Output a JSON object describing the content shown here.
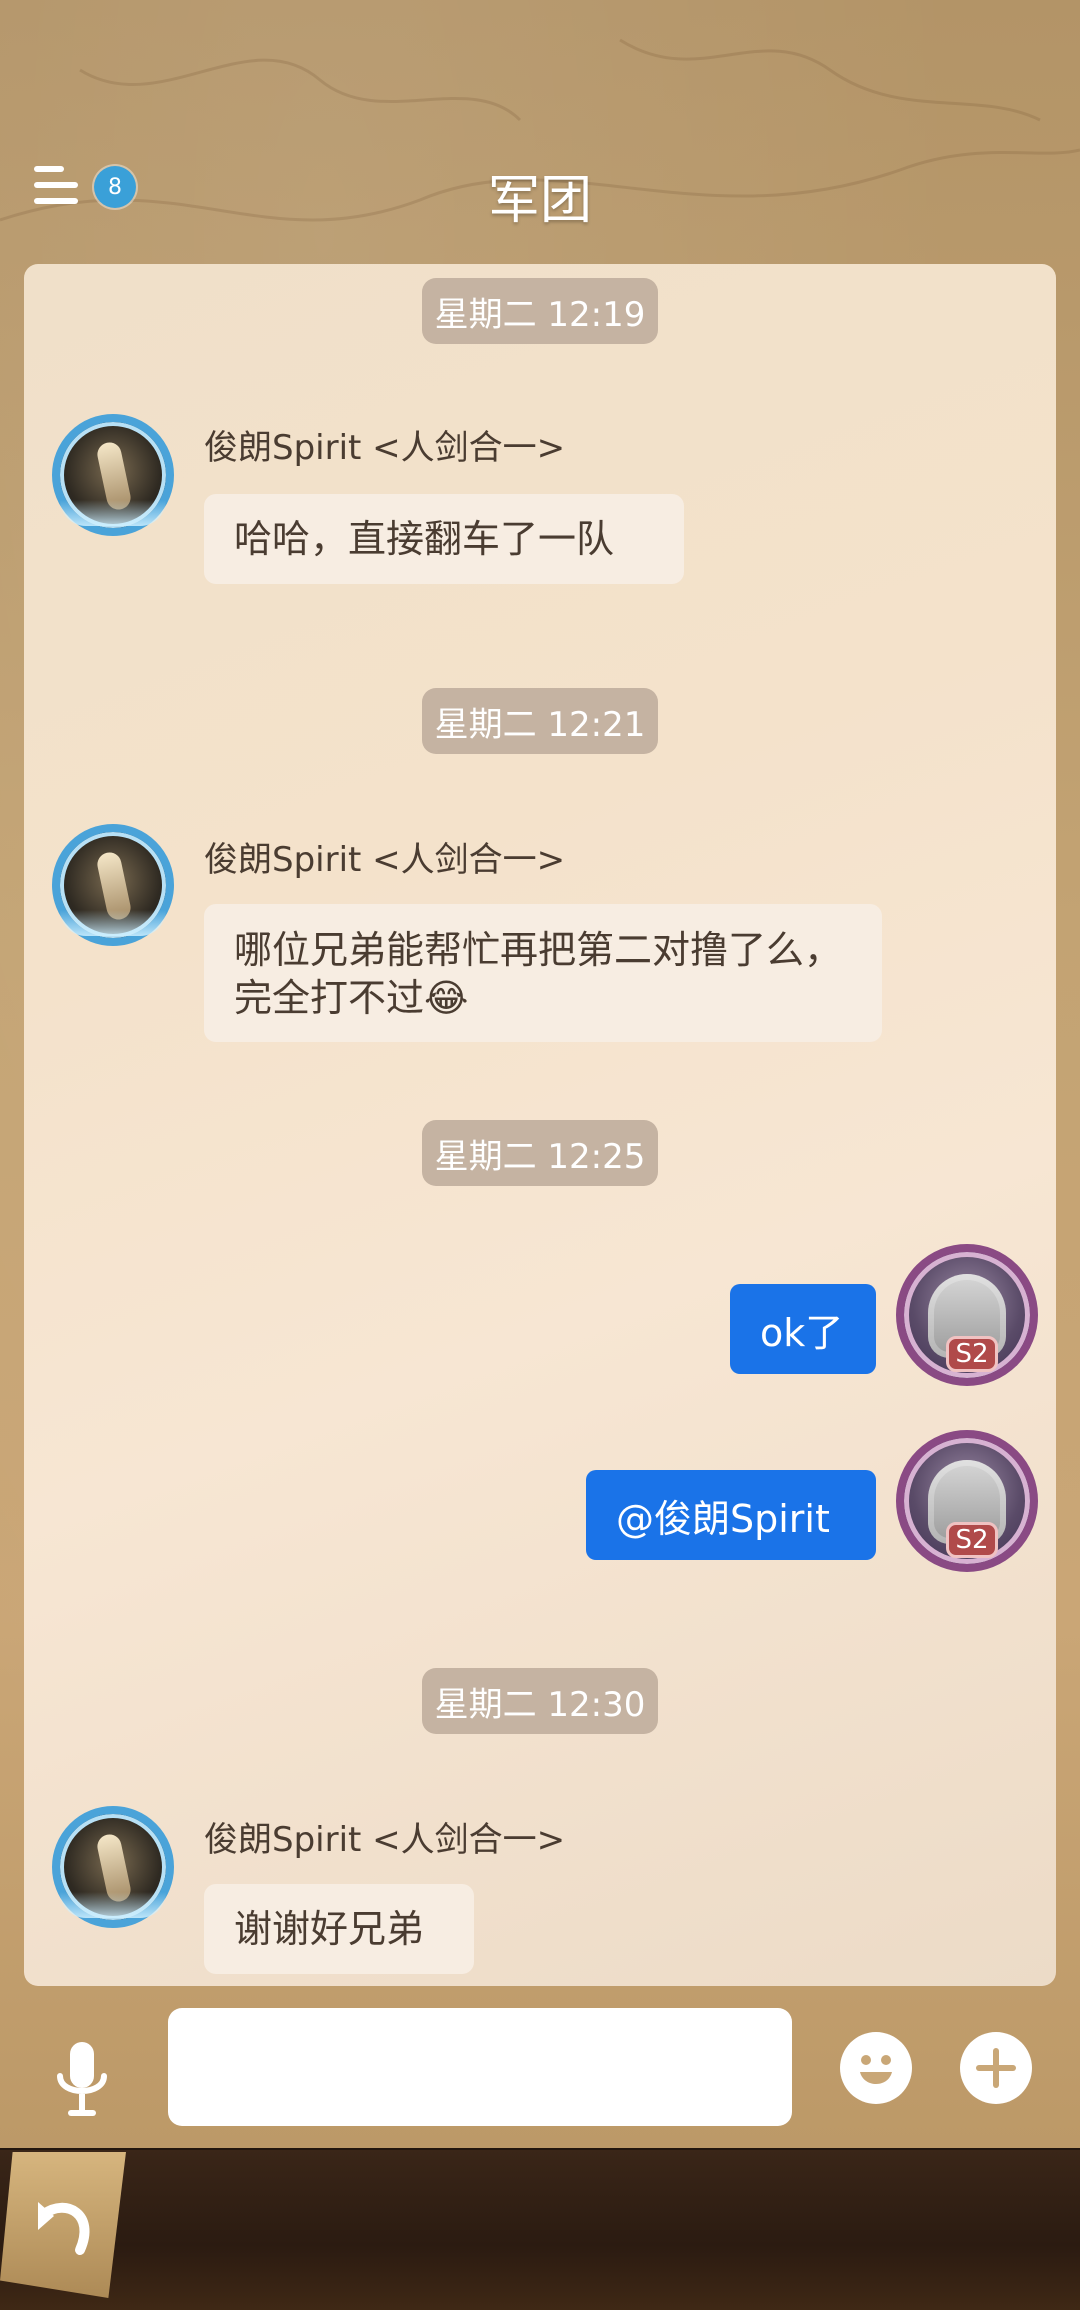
{
  "header": {
    "title": "军团",
    "notification_count": "8"
  },
  "chat": {
    "messages": [
      {
        "type": "timestamp",
        "text": "星期二 12:19"
      },
      {
        "type": "incoming",
        "sender": "俊朗Spirit <人剑合一>",
        "text": "哈哈，直接翻车了一队"
      },
      {
        "type": "timestamp",
        "text": "星期二 12:21"
      },
      {
        "type": "incoming",
        "sender": "俊朗Spirit <人剑合一>",
        "text": "哪位兄弟能帮忙再把第二对撸了么，完全打不过😂"
      },
      {
        "type": "timestamp",
        "text": "星期二 12:25"
      },
      {
        "type": "outgoing",
        "text": "ok了",
        "avatar_badge": "S2"
      },
      {
        "type": "outgoing",
        "text": "@俊朗Spirit",
        "avatar_badge": "S2"
      },
      {
        "type": "timestamp",
        "text": "星期二 12:30"
      },
      {
        "type": "incoming",
        "sender": "俊朗Spirit <人剑合一>",
        "text": "谢谢好兄弟"
      }
    ]
  },
  "input": {
    "value": "",
    "placeholder": ""
  },
  "icons": {
    "menu": "menu-icon",
    "mic": "mic-icon",
    "emoji": "emoji-icon",
    "plus": "plus-icon",
    "back": "back-arrow-icon"
  },
  "colors": {
    "outgoing_bubble": "#1a73e8",
    "incoming_bubble": "#f7ede2",
    "timestamp_pill": "#c5b3a2",
    "badge": "#3aa0d8"
  }
}
